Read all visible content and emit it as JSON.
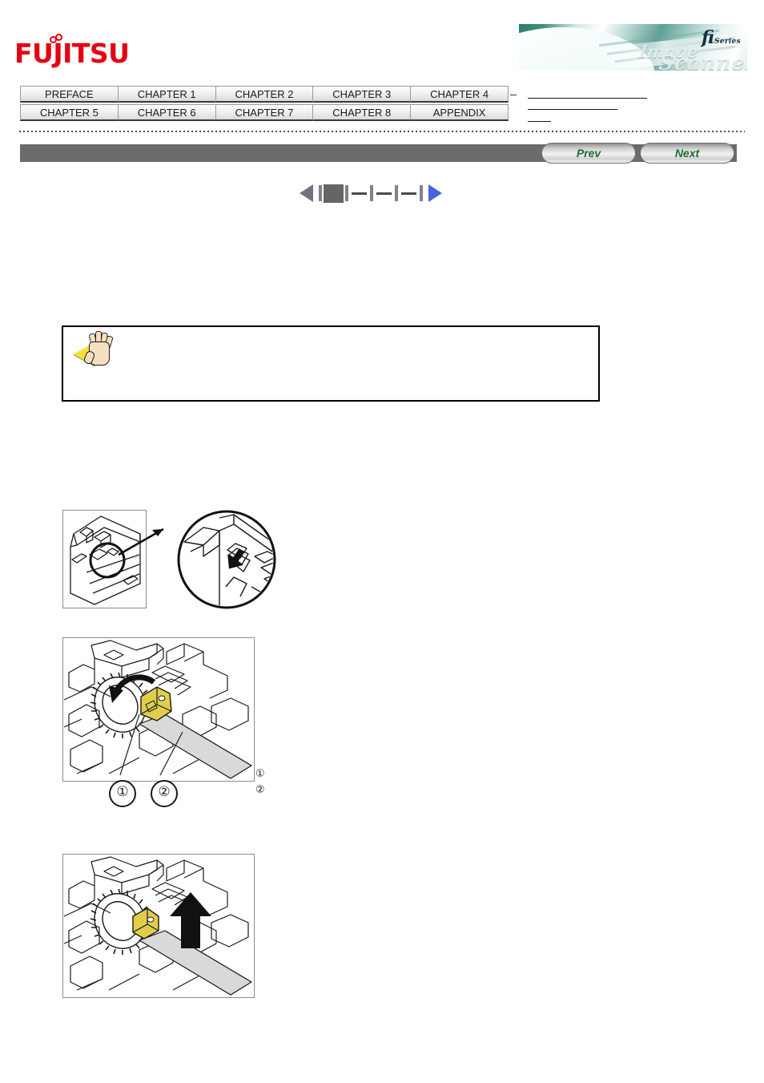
{
  "brand": {
    "logo_text": "FUJITSU",
    "logo_color": "#e60012",
    "banner_fi": "fi",
    "banner_series": "Series",
    "banner_script_top": "Image",
    "banner_script_bottom": "Scanner"
  },
  "tabs": {
    "row1": [
      "PREFACE",
      "CHAPTER 1",
      "CHAPTER 2",
      "CHAPTER 3",
      "CHAPTER 4"
    ],
    "row2": [
      "CHAPTER 5",
      "CHAPTER 6",
      "CHAPTER 7",
      "CHAPTER 8",
      "APPENDIX"
    ]
  },
  "navbar": {
    "prev_label": "Prev",
    "next_label": "Next",
    "bar_color": "#6b6b6b",
    "label_color": "#1f6b2f"
  },
  "pager": {
    "prev_arrow_color": "#6f7380",
    "next_arrow_color": "#4a63d8",
    "current_marker_color": "#656565",
    "tick_count": 4,
    "dash_count": 3,
    "current_index": 1
  },
  "caution": {
    "icon": "stop-hand-icon",
    "icon_triangle_color": "#f5e03a",
    "icon_hand_color": "#f6dfc0",
    "text": ""
  },
  "figures": [
    {
      "name": "scanner-latch-detail",
      "caption": "",
      "has_magnifier": true,
      "callouts": []
    },
    {
      "name": "pick-roller-clamp-rotate",
      "caption": "",
      "clamp_color": "#e0cd4a",
      "shaft_color": "#d9d9d9",
      "callouts": [
        "①",
        "②"
      ],
      "edge_markers": [
        "①",
        "②"
      ]
    },
    {
      "name": "pick-roller-remove-lift",
      "caption": "",
      "clamp_color": "#e0cd4a",
      "shaft_color": "#d9d9d9",
      "arrow_direction": "up",
      "callouts": []
    }
  ]
}
